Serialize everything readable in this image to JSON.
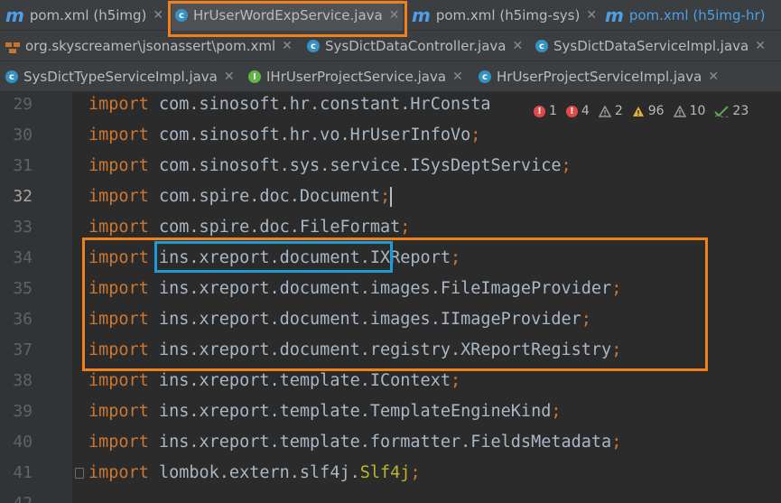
{
  "tabs_row1": [
    {
      "label": "pom.xml (h5img)",
      "icon": "maven-icon"
    },
    {
      "label": "HrUserWordExpService.java",
      "icon": "class-icon"
    },
    {
      "label": "pom.xml (h5img-sys)",
      "icon": "maven-icon"
    },
    {
      "label": "pom.xml (h5img-hr)",
      "icon": "maven-icon"
    }
  ],
  "tabs_row2": [
    {
      "label": "org.skyscreamer\\jsonassert\\pom.xml",
      "icon": "package-icon"
    },
    {
      "label": "SysDictDataController.java",
      "icon": "class-icon"
    },
    {
      "label": "SysDictDataServiceImpl.java",
      "icon": "class-icon"
    }
  ],
  "tabs_row3": [
    {
      "label": "SysDictTypeServiceImpl.java",
      "icon": "class-icon"
    },
    {
      "label": "IHrUserProjectService.java",
      "icon": "interface-icon"
    },
    {
      "label": "HrUserProjectServiceImpl.java",
      "icon": "class-icon"
    }
  ],
  "inspections": {
    "errors": "1",
    "warnings_red": "4",
    "weak_warnings": "2",
    "warnings": "96",
    "typos": "10",
    "passed": "23"
  },
  "code_lines": [
    {
      "num": "29",
      "kw": "import",
      "pkg": "com.sinosoft.hr.constant.HrConsta",
      "semi": ""
    },
    {
      "num": "30",
      "kw": "import",
      "pkg": "com.sinosoft.hr.vo.HrUserInfoVo",
      "semi": ";"
    },
    {
      "num": "31",
      "kw": "import",
      "pkg": "com.sinosoft.sys.service.ISysDeptService",
      "semi": ";"
    },
    {
      "num": "32",
      "kw": "import",
      "pkg": "com.spire.doc.Document",
      "semi": ";"
    },
    {
      "num": "33",
      "kw": "import",
      "pkg": "com.spire.doc.FileFormat",
      "semi": ";"
    },
    {
      "num": "34",
      "kw": "import",
      "pkg": "ins.xreport.document.IXReport",
      "semi": ";"
    },
    {
      "num": "35",
      "kw": "import",
      "pkg": "ins.xreport.document.images.FileImageProvider",
      "semi": ";"
    },
    {
      "num": "36",
      "kw": "import",
      "pkg": "ins.xreport.document.images.IImageProvider",
      "semi": ";"
    },
    {
      "num": "37",
      "kw": "import",
      "pkg": "ins.xreport.document.registry.XReportRegistry",
      "semi": ";"
    },
    {
      "num": "38",
      "kw": "import",
      "pkg": "ins.xreport.template.IContext",
      "semi": ";"
    },
    {
      "num": "39",
      "kw": "import",
      "pkg": "ins.xreport.template.TemplateEngineKind",
      "semi": ";"
    },
    {
      "num": "40",
      "kw": "import",
      "pkg": "ins.xreport.template.formatter.FieldsMetadata",
      "semi": ";"
    },
    {
      "num": "41",
      "kw": "import",
      "pkg": "lombok.extern.slf4j.",
      "cls": "Slf4j",
      "semi": ";"
    },
    {
      "num": "42",
      "kw": "",
      "pkg": "",
      "semi": ""
    }
  ],
  "colors": {
    "keyword": "#cc7832",
    "text": "#a9b7c6",
    "highlight_orange": "#f0801a",
    "highlight_blue": "#1d9bd7"
  }
}
